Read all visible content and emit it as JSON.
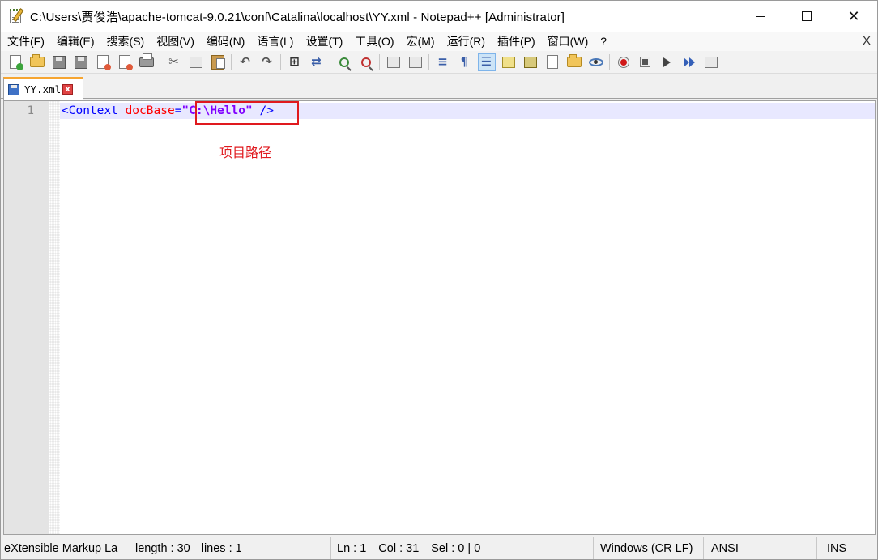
{
  "window": {
    "title": "C:\\Users\\贾俊浩\\apache-tomcat-9.0.21\\conf\\Catalina\\localhost\\YY.xml - Notepad++ [Administrator]",
    "minimize_glyph": "",
    "close_glyph": "✕"
  },
  "menu": {
    "items": [
      {
        "label": "文件(F)"
      },
      {
        "label": "编辑(E)"
      },
      {
        "label": "搜索(S)"
      },
      {
        "label": "视图(V)"
      },
      {
        "label": "编码(N)"
      },
      {
        "label": "语言(L)"
      },
      {
        "label": "设置(T)"
      },
      {
        "label": "工具(O)"
      },
      {
        "label": "宏(M)"
      },
      {
        "label": "运行(R)"
      },
      {
        "label": "插件(P)"
      },
      {
        "label": "窗口(W)"
      },
      {
        "label": "?"
      }
    ],
    "close_label": "X"
  },
  "toolbar": {
    "icons": [
      "new-file-icon",
      "open-folder-icon",
      "save-icon",
      "save-all-icon",
      "close-icon",
      "close-all-icon",
      "print-icon",
      "cut-icon",
      "copy-icon",
      "paste-icon",
      "undo-icon",
      "redo-icon",
      "find-icon",
      "replace-icon",
      "zoom-in-icon",
      "zoom-out-icon",
      "sync-vertical-icon",
      "sync-horizontal-icon",
      "word-wrap-icon",
      "show-all-chars-icon",
      "indent-guide-icon",
      "udl-icon",
      "doc-map-icon",
      "function-list-icon",
      "folder-workspace-icon",
      "monitoring-icon",
      "record-macro-icon",
      "stop-record-icon",
      "playback-icon",
      "run-multiple-icon",
      "save-macro-icon"
    ],
    "pilcrow": "¶",
    "active_icon": "indent-guide-icon"
  },
  "tabs": [
    {
      "label": "YY.xml",
      "active": true,
      "close_glyph": "x"
    }
  ],
  "editor": {
    "line_number": "1",
    "tokens": {
      "open": "<Context",
      "attr": " docBase",
      "eq": "=",
      "value": "\"C:\\Hello\"",
      "close": " />"
    },
    "annotation": "项目路径"
  },
  "status": {
    "language": "eXtensible Markup La",
    "length": "length : 30",
    "lines": "lines : 1",
    "ln": "Ln : 1",
    "col": "Col : 31",
    "sel": "Sel : 0 | 0",
    "eol": "Windows (CR LF)",
    "encoding": "ANSI",
    "mode": "INS"
  },
  "colors": {
    "tag": "#0000ff",
    "attribute": "#ff0000",
    "string": "#8000ff",
    "annotation": "#e0191e",
    "tab_accent": "#f6a531",
    "current_line": "#e8e8ff"
  }
}
